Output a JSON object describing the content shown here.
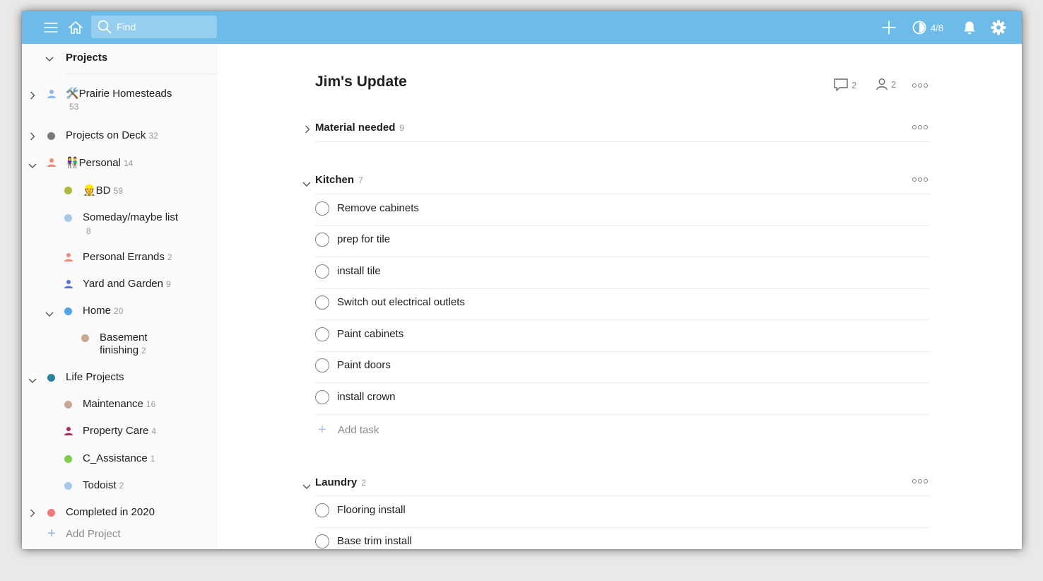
{
  "colors": {
    "topbar": "#6cbbe8",
    "sidebar_bg": "#fafafa",
    "accent_plus": "#8fb6e8"
  },
  "topbar": {
    "menu_icon": "hamburger-icon",
    "home_icon": "home-icon",
    "search_placeholder": "Find",
    "add_icon": "plus-icon",
    "productivity_icon": "half-circle-icon",
    "karma": "4/8",
    "notifications_icon": "bell-icon",
    "settings_icon": "gear-icon"
  },
  "sidebar": {
    "header": "Projects",
    "add_project": "Add Project",
    "projects": [
      {
        "name": "🛠️Prairie Homesteads",
        "count": "53",
        "icon": "person-icon",
        "color": "#8fb6e8",
        "expanded": false
      },
      {
        "name": "Projects on Deck",
        "count": "32",
        "icon": "dot",
        "color": "#7a7a7a",
        "expanded": false
      },
      {
        "name": "👫Personal",
        "count": "14",
        "icon": "person-icon",
        "color": "#f28a7a",
        "expanded": true
      },
      {
        "name": "👷BD",
        "count": "59",
        "icon": "dot",
        "color": "#afb83b"
      },
      {
        "name": "Someday/maybe list",
        "count": "8",
        "icon": "dot",
        "color": "#a8c8eb"
      },
      {
        "name": "Personal Errands",
        "count": "2",
        "icon": "person-icon",
        "color": "#f28a7a"
      },
      {
        "name": "Yard and Garden",
        "count": "9",
        "icon": "person-icon",
        "color": "#5a6ee8"
      },
      {
        "name": "Home",
        "count": "20",
        "icon": "dot",
        "color": "#4ea4e8",
        "expanded": true
      },
      {
        "name": "Basement finishing",
        "count": "2",
        "icon": "dot",
        "color": "#c9a893"
      },
      {
        "name": "Life Projects",
        "count": "",
        "icon": "dot",
        "color": "#29839e",
        "expanded": true
      },
      {
        "name": "Maintenance",
        "count": "16",
        "icon": "dot",
        "color": "#c9a893"
      },
      {
        "name": "Property Care",
        "count": "4",
        "icon": "person-icon",
        "color": "#b8255f"
      },
      {
        "name": "C_Assistance",
        "count": "1",
        "icon": "dot",
        "color": "#7ecc49"
      },
      {
        "name": "Todoist",
        "count": "2",
        "icon": "dot",
        "color": "#a8c8eb"
      },
      {
        "name": "Completed in 2020",
        "count": "",
        "icon": "dot",
        "color": "#f07a78",
        "expanded": false
      }
    ]
  },
  "main": {
    "title": "Jim's Update",
    "comments_count": "2",
    "collaborators_count": "2",
    "sections": [
      {
        "name": "Material needed",
        "count": "9",
        "expanded": false
      },
      {
        "name": "Kitchen",
        "count": "7",
        "expanded": true,
        "tasks": [
          "Remove cabinets",
          "prep for tile",
          "install tile",
          "Switch out electrical outlets",
          "Paint cabinets",
          "Paint doors",
          "install crown"
        ]
      },
      {
        "name": "Laundry",
        "count": "2",
        "expanded": true,
        "tasks": [
          "Flooring install",
          "Base trim install"
        ]
      }
    ],
    "add_task": "Add task"
  }
}
